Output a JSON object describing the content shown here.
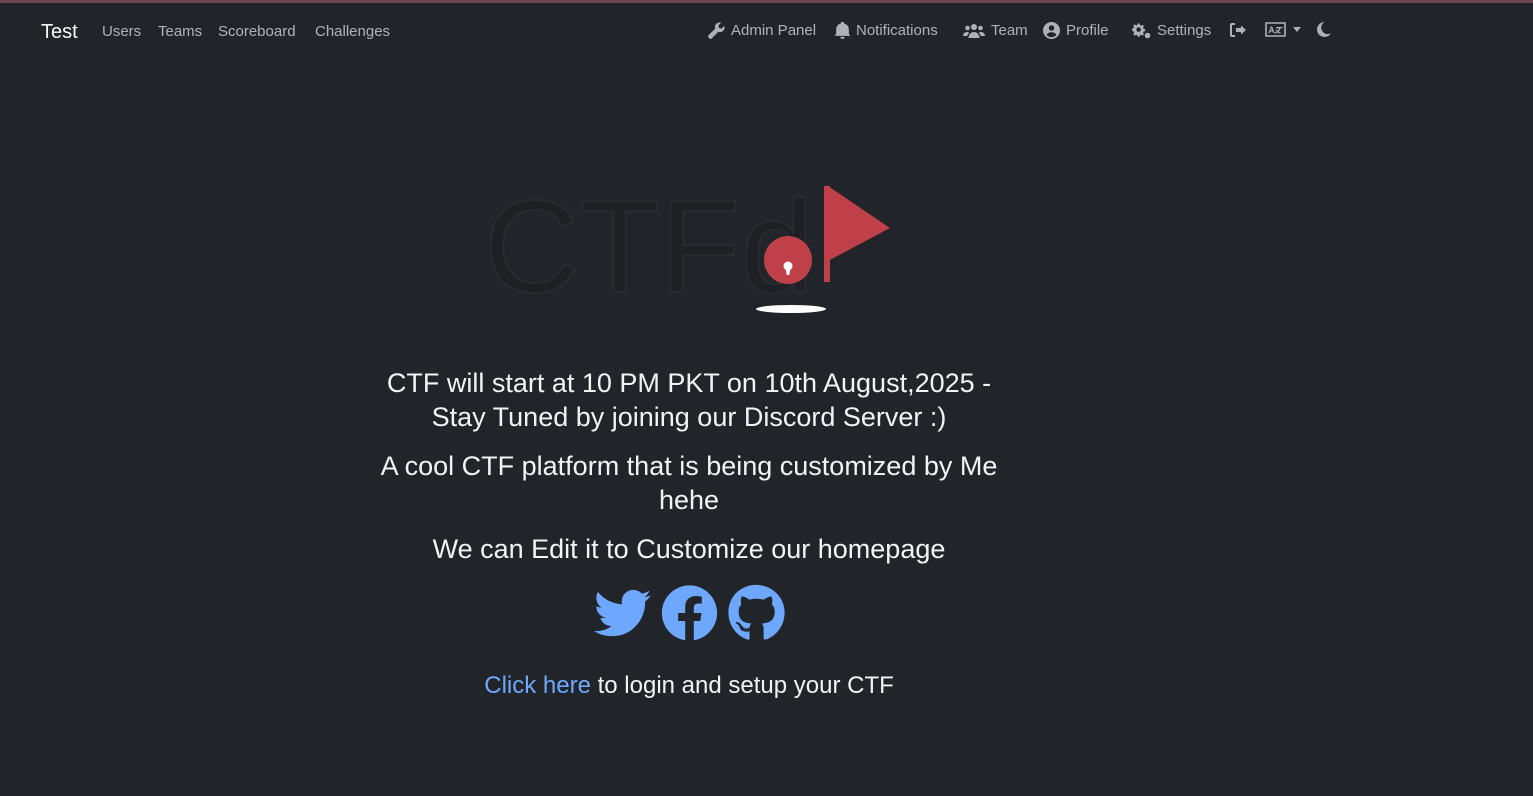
{
  "navbar": {
    "brand": "Test",
    "left_links": [
      "Users",
      "Teams",
      "Scoreboard",
      "Challenges"
    ],
    "right_links": {
      "admin": "Admin Panel",
      "notifications": "Notifications",
      "team": "Team",
      "profile": "Profile",
      "settings": "Settings"
    },
    "icons": [
      "wrench-icon",
      "bell-icon",
      "users-icon",
      "user-circle-icon",
      "cogs-icon",
      "logout-icon",
      "language-icon",
      "moon-icon"
    ]
  },
  "logo": {
    "text": "CTFd",
    "flag_color": "#c0404a"
  },
  "main": {
    "paragraph1_line1": "CTF will start at 10 PM PKT on 10th August,2025 -",
    "paragraph1_line2": "Stay Tuned by joining our Discord Server :)",
    "paragraph2_line1": "A cool CTF platform that is being customized by Me",
    "paragraph2_line2": "hehe",
    "paragraph3": "We can Edit it to Customize our homepage",
    "social_icons": [
      "twitter-icon",
      "facebook-icon",
      "github-icon"
    ],
    "login_link": "Click here",
    "login_text": " to login and setup your CTF"
  },
  "colors": {
    "background": "#212529",
    "link": "#6ea8fe",
    "accent": "#c0404a"
  }
}
